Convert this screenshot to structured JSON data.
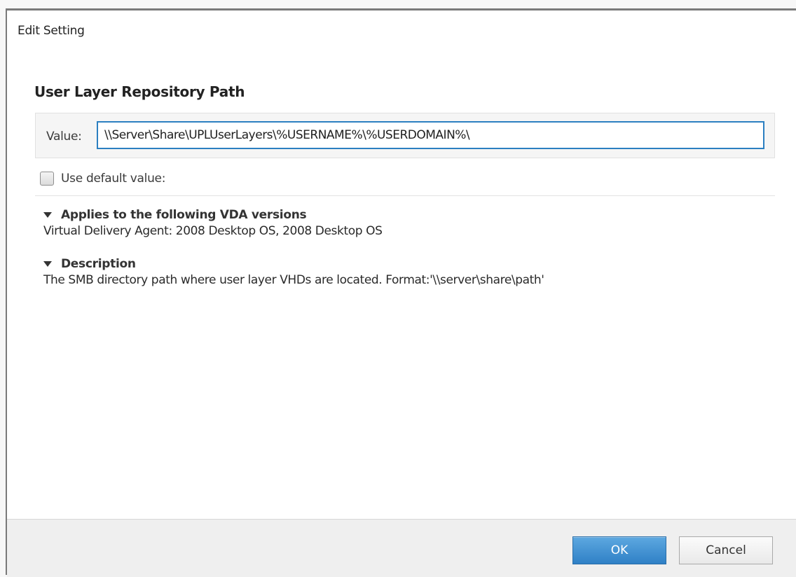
{
  "dialog": {
    "title": "Edit Setting",
    "heading": "User Layer Repository Path"
  },
  "value_field": {
    "label": "Value:",
    "value": "\\\\Server\\Share\\UPLUserLayers\\%USERNAME%\\%USERDOMAIN%\\"
  },
  "default_checkbox": {
    "label": "Use default value:",
    "checked": false
  },
  "sections": [
    {
      "title": "Applies to the following VDA versions",
      "body": "Virtual Delivery Agent: 2008 Desktop OS, 2008 Desktop OS",
      "expanded": true
    },
    {
      "title": "Description",
      "body": "The SMB directory path where user layer VHDs are located. Format:'\\\\server\\share\\path'",
      "expanded": true
    }
  ],
  "footer": {
    "ok_label": "OK",
    "cancel_label": "Cancel"
  },
  "colors": {
    "accent": "#2b7fc1",
    "ok_button": "#3a8ccf"
  }
}
